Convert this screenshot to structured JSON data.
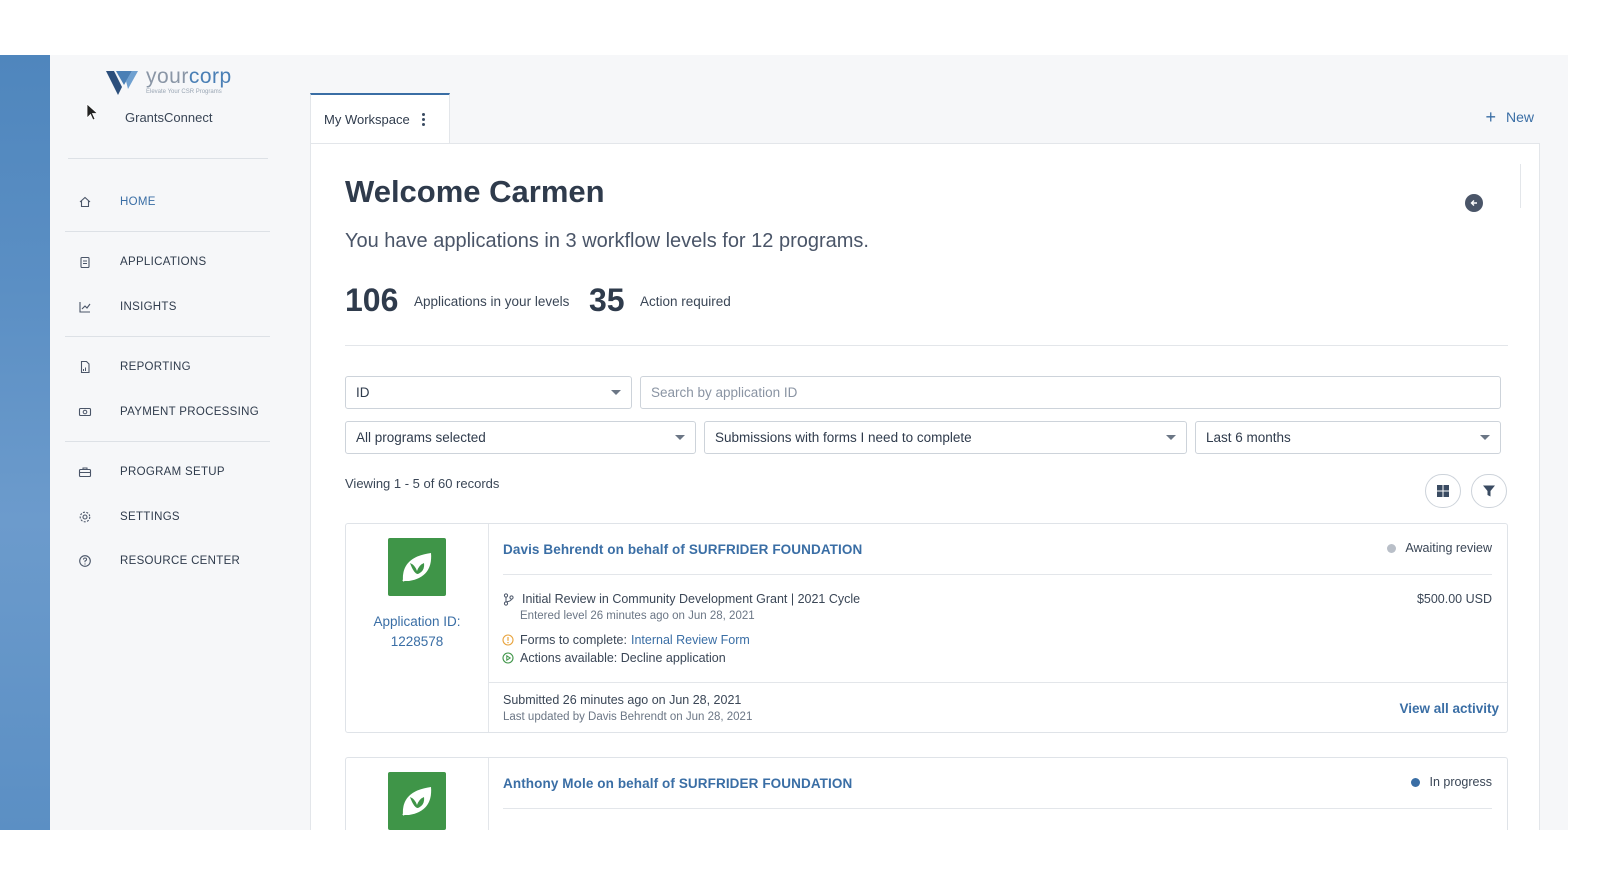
{
  "brand": {
    "name_prefix": "your",
    "name_suffix": "corp",
    "tagline": "Elevate Your CSR Programs",
    "app_name": "GrantsConnect"
  },
  "nav": {
    "home": "HOME",
    "applications": "APPLICATIONS",
    "insights": "INSIGHTS",
    "reporting": "REPORTING",
    "payment_processing": "PAYMENT PROCESSING",
    "program_setup": "PROGRAM SETUP",
    "settings": "SETTINGS",
    "resource_center": "RESOURCE CENTER"
  },
  "tab": {
    "label": "My Workspace"
  },
  "header": {
    "new_label": "New"
  },
  "welcome": {
    "title": "Welcome Carmen",
    "subtitle": "You have applications in 3 workflow levels for 12 programs.",
    "stat1_value": "106",
    "stat1_label": "Applications in your levels",
    "stat2_value": "35",
    "stat2_label": "Action required"
  },
  "filters": {
    "id_select": "ID",
    "search_placeholder": "Search by application ID",
    "programs_select": "All programs selected",
    "submissions_select": "Submissions with forms I need to complete",
    "period_select": "Last 6 months",
    "viewing": "Viewing 1 - 5 of 60 records"
  },
  "cards": [
    {
      "app_id_label": "Application ID:",
      "app_id": "1228578",
      "name": "Davis Behrendt on behalf of SURFRIDER FOUNDATION",
      "status": "Awaiting review",
      "status_color": "#b9bfc8",
      "level": "Initial Review in Community Development Grant | 2021 Cycle",
      "entered": "Entered level 26 minutes ago on Jun 28, 2021",
      "amount": "$500.00 USD",
      "forms_label": "Forms to complete:",
      "forms_link": "Internal Review Form",
      "actions": "Actions available: Decline application",
      "submitted": "Submitted 26 minutes ago on Jun 28, 2021",
      "updated": "Last updated by Davis Behrendt on Jun 28, 2021",
      "activity": "View all activity"
    },
    {
      "name": "Anthony Mole on behalf of SURFRIDER FOUNDATION",
      "status": "In progress",
      "status_color": "#3a6ea5"
    }
  ]
}
